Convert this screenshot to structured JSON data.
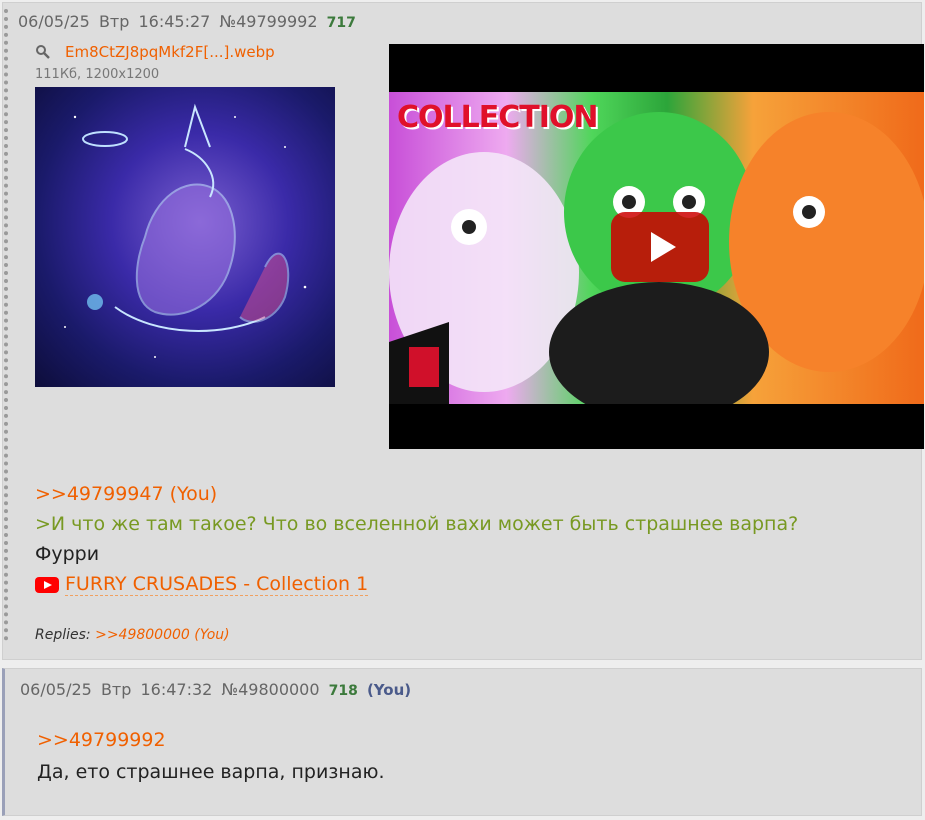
{
  "post1": {
    "date": "06/05/25",
    "day": "Втр",
    "time": "16:45:27",
    "number": "№49799992",
    "position": "717",
    "file": {
      "name": "Em8CtZJ8pqMkf2F[...].webp",
      "meta": "111Кб, 1200x1200"
    },
    "video": {
      "thumb_title": "COLLECTION"
    },
    "reply_link": ">>49799947 (You)",
    "greentext": ">И что же там такое? Что во вселенной вахи может быть страшнее варпа?",
    "text": "Фурри",
    "youtube_title": "FURRY CRUSADES - Collection 1",
    "replies_label": "Replies:",
    "replies_link": ">>49800000 (You)"
  },
  "post2": {
    "date": "06/05/25",
    "day": "Втр",
    "time": "16:47:32",
    "number": "№49800000",
    "position": "718",
    "you_tag": "(You)",
    "reply_link": ">>49799992",
    "text": "Да, ето страшнее варпа, признаю."
  },
  "colors": {
    "background": "#eeeeee",
    "post_background": "#dddddd",
    "link": "#f06000",
    "greentext": "#789922",
    "post_position": "#3c7a3c"
  }
}
